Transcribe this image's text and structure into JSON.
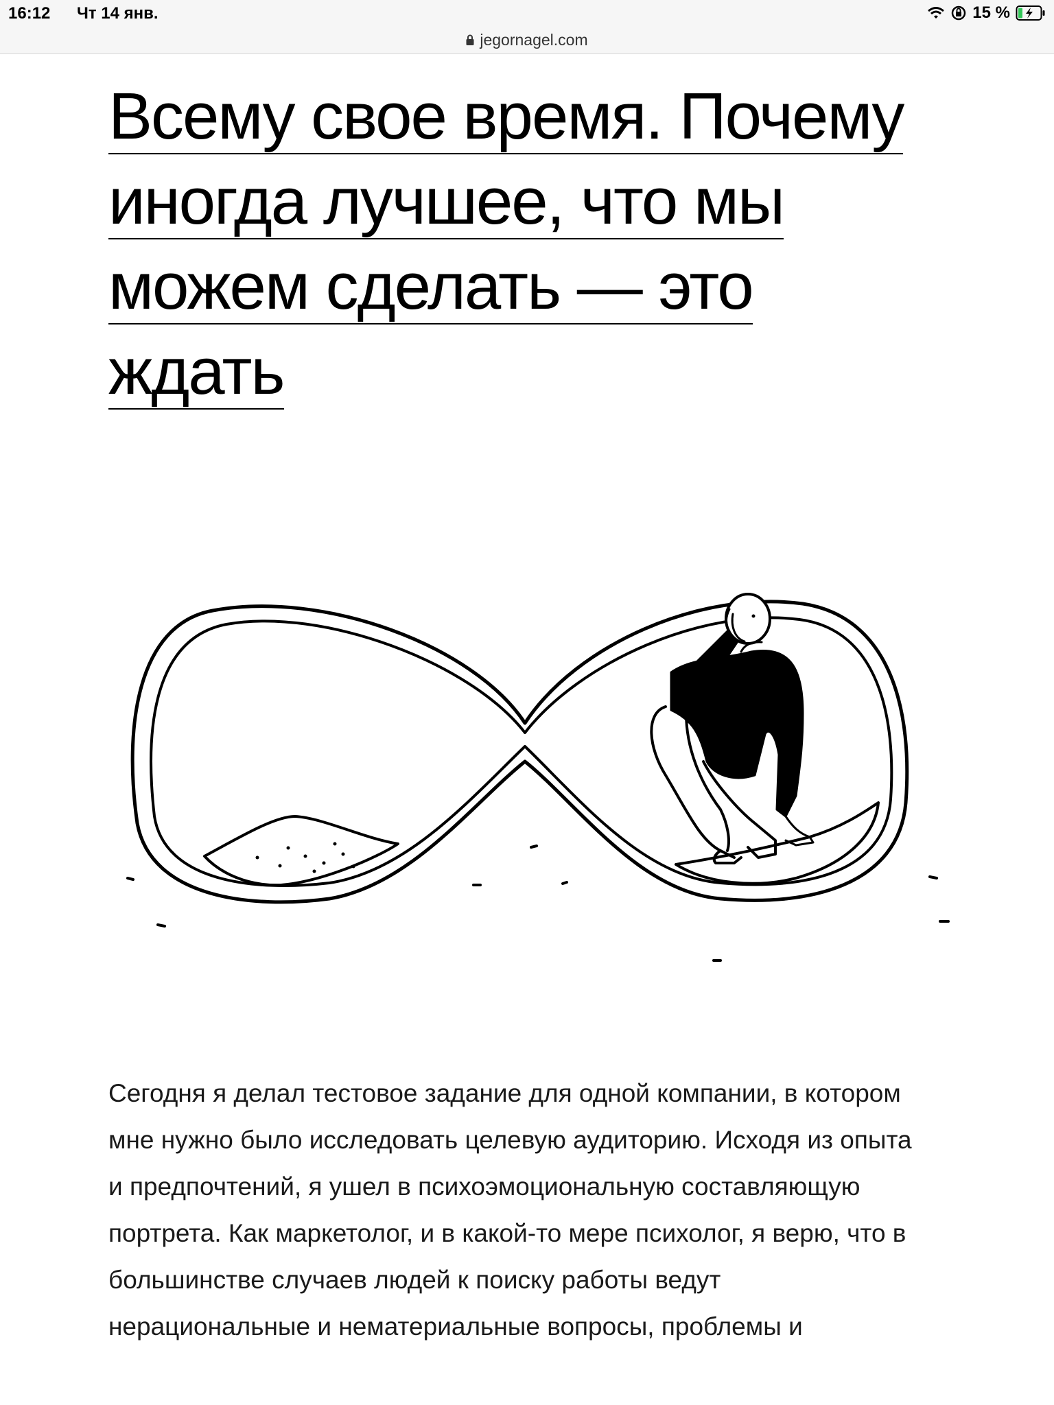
{
  "status_bar": {
    "time": "16:12",
    "date": "Чт 14 янв.",
    "battery_percent": "15 %",
    "icons": [
      "wifi-icon",
      "rotation-lock-icon",
      "battery-charging-icon"
    ]
  },
  "browser": {
    "url": "jegornagel.com",
    "secure_icon": "lock-icon"
  },
  "article": {
    "title": "Всему свое время. Почему иногда лучшее, что мы можем сделать — это ждать",
    "illustration": "hourglass-with-seated-man-illustration",
    "body": "Сегодня я делал тестовое задание для одной компании, в котором мне нужно было исследовать целевую аудиторию. Исходя из опыта и предпочтений, я ушел в психоэмоциональную составляющую портрета. Как маркетолог, и в какой-то мере психолог, я верю, что в большинстве случаев людей к поиску работы ведут нерациональные и нематериальные вопросы, проблемы и"
  }
}
